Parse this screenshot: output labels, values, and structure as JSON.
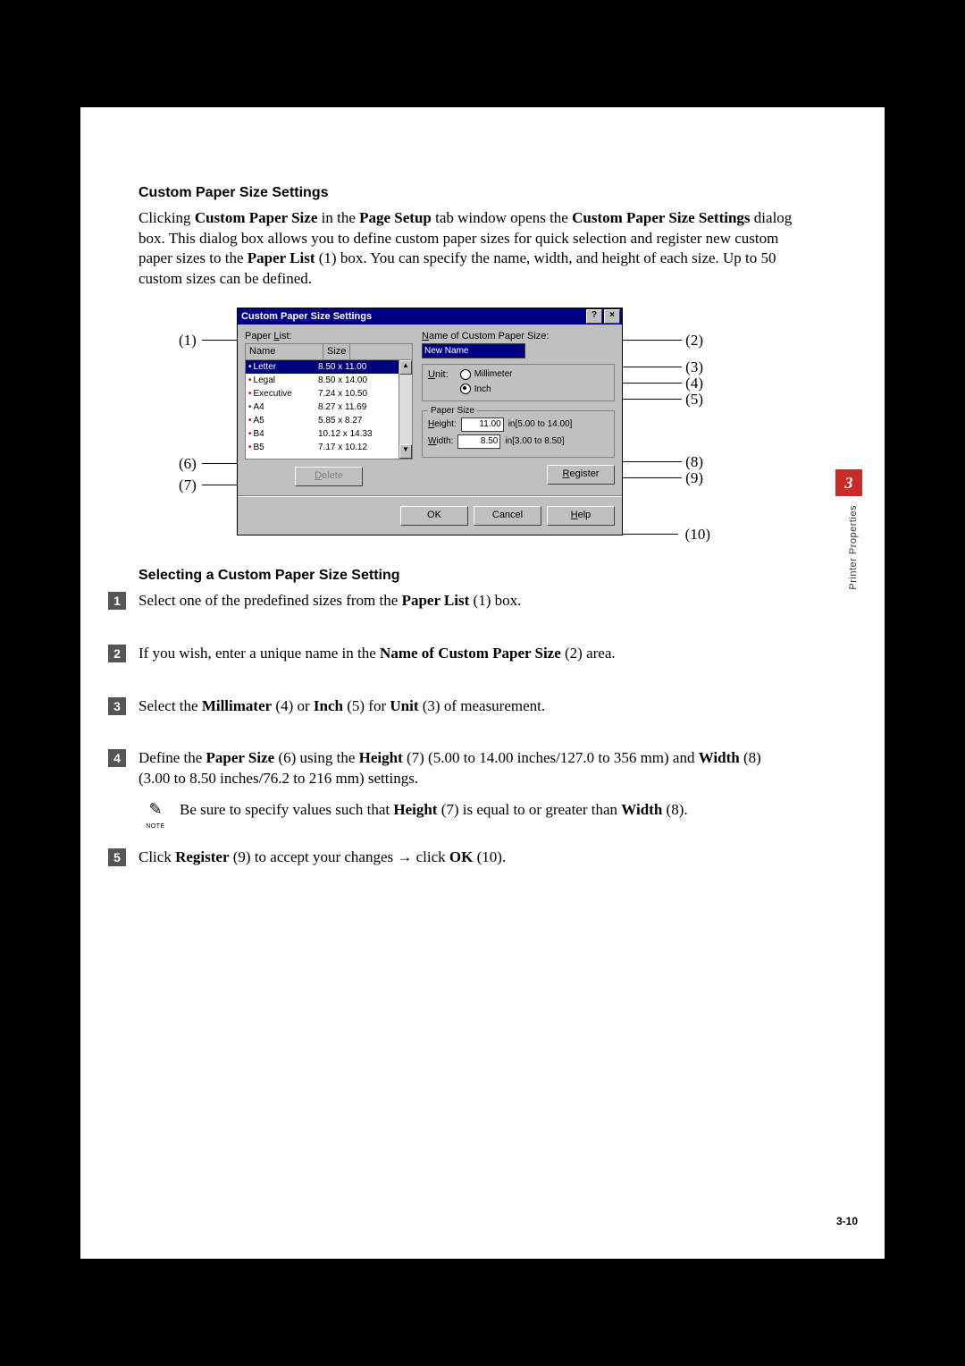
{
  "side": {
    "num": "3",
    "label": "Printer Properties"
  },
  "page_num": "3-10",
  "h1": "Custom Paper Size Settings",
  "intro": {
    "pre": "Clicking ",
    "b1": "Custom Paper Size",
    "mid1": " in the ",
    "b2": "Page Setup",
    "mid2": " tab window opens the ",
    "b3": "Custom Paper Size Settings",
    "mid3": " dialog box. This dialog box allows you to define custom paper sizes for quick selection and register new custom paper sizes to the ",
    "b4": "Paper List",
    "post": " (1) box. You can specify the name, width, and height of each size. Up to 50 custom sizes can be defined."
  },
  "dlg": {
    "title": "Custom Paper Size Settings",
    "paper_list_label": "Paper List:",
    "name_label": "Name of Custom Paper Size:",
    "unit_label": "Unit:",
    "list": {
      "head_name": "Name",
      "head_size": "Size",
      "rows": [
        {
          "name": "Letter",
          "size": "8.50 x 11.00"
        },
        {
          "name": "Legal",
          "size": "8.50 x 14.00"
        },
        {
          "name": "Executive",
          "size": "7.24 x 10.50"
        },
        {
          "name": "A4",
          "size": "8.27 x 11.69"
        },
        {
          "name": "A5",
          "size": "5.85 x 8.27"
        },
        {
          "name": "B4",
          "size": "10.12 x 14.33"
        },
        {
          "name": "B5",
          "size": "7.17 x 10.12"
        }
      ]
    },
    "new_name": "New Name",
    "unit_mm": "Millimeter",
    "unit_in": "Inch",
    "papersize_legend": "Paper Size",
    "height_label": "Height:",
    "height_val": "11.00",
    "height_range": "in[5.00 to 14.00]",
    "width_label": "Width:",
    "width_val": "8.50",
    "width_range": "in[3.00 to 8.50]",
    "delete": "Delete",
    "register": "Register",
    "ok": "OK",
    "cancel": "Cancel",
    "help": "Help"
  },
  "callouts": {
    "c1": "(1)",
    "c2": "(2)",
    "c3": "(3)",
    "c4": "(4)",
    "c5": "(5)",
    "c6": "(6)",
    "c7": "(7)",
    "c8": "(8)",
    "c9": "(9)",
    "c10": "(10)"
  },
  "h2": "Selecting a Custom Paper Size Setting",
  "steps": {
    "n1": "1",
    "n2": "2",
    "n3": "3",
    "n4": "4",
    "n5": "5",
    "s1": {
      "pre": "Select one of the predefined sizes from the ",
      "b": "Paper List",
      "post": " (1) box."
    },
    "s2": {
      "pre": "If you wish, enter a unique name in the ",
      "b": "Name of Custom Paper Size",
      "post": " (2) area."
    },
    "s3": {
      "pre": "Select the ",
      "b1": "Millimater",
      "mid": " (4) or ",
      "b2": "Inch",
      "mid2": " (5) for ",
      "b3": "Unit",
      "post": " (3) of measurement."
    },
    "s4": {
      "pre": "Define the ",
      "b1": "Paper Size",
      "mid1": " (6) using the ",
      "b2": "Height",
      "mid2": " (7) (5.00 to 14.00 inches/127.0 to 356 mm) and ",
      "b3": "Width",
      "mid3": " (8) (3.00 to 8.50 inches/76.2 to 216 mm) settings."
    },
    "note": {
      "lbl": "NOTE",
      "pre": "Be sure to specify values such that ",
      "b1": "Height",
      "mid": " (7) is equal to or greater than ",
      "b2": "Width",
      "post": " (8)."
    },
    "s5": {
      "pre": "Click ",
      "b1": "Register",
      "mid": " (9) to accept your changes → click ",
      "b2": "OK",
      "post": " (10)."
    }
  }
}
